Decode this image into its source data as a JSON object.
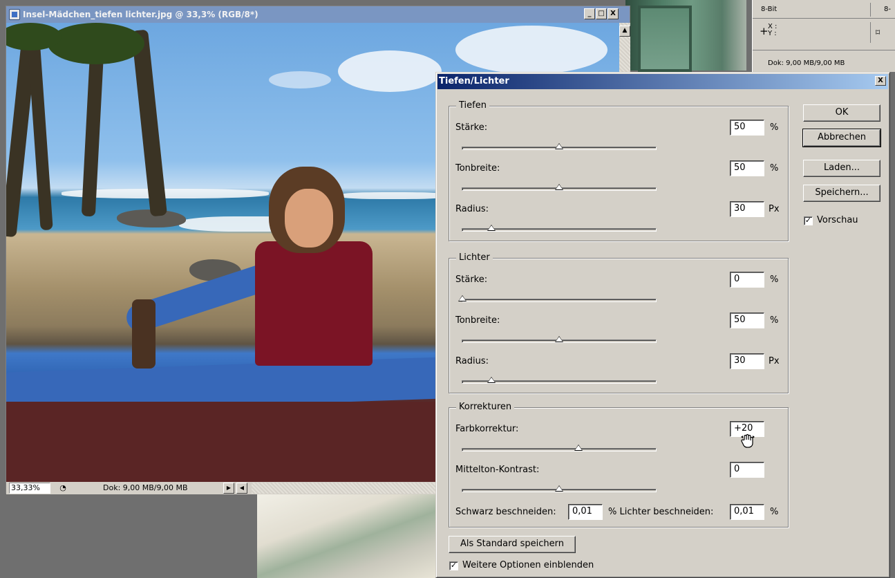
{
  "document": {
    "title": "Insel-Mädchen_tiefen lichter.jpg @ 33,3% (RGB/8*)",
    "zoom": "33,33%",
    "doc_info": "Dok: 9,00 MB/9,00 MB",
    "minimize_glyph": "_",
    "maximize_glyph": "□",
    "close_glyph": "X",
    "scroll_up_glyph": "▲",
    "nav_right_glyph": "▶",
    "nav_left_glyph": "◀"
  },
  "info_panel": {
    "bit_depth_left": "8-Bit",
    "bit_depth_right": "8-",
    "xy_label": "X :\nY :",
    "doc_info": "Dok: 9,00 MB/9,00 MB"
  },
  "dialog": {
    "title": "Tiefen/Lichter",
    "close_glyph": "X",
    "groups": {
      "tiefen": {
        "legend": "Tiefen",
        "staerke": {
          "label": "Stärke:",
          "value": "50",
          "unit": "%",
          "level": 0.5
        },
        "tonbreite": {
          "label": "Tonbreite:",
          "value": "50",
          "unit": "%",
          "level": 0.5
        },
        "radius": {
          "label": "Radius:",
          "value": "30",
          "unit": "Px",
          "level": 0.15
        }
      },
      "lichter": {
        "legend": "Lichter",
        "staerke": {
          "label": "Stärke:",
          "value": "0",
          "unit": "%",
          "level": 0.0
        },
        "tonbreite": {
          "label": "Tonbreite:",
          "value": "50",
          "unit": "%",
          "level": 0.5
        },
        "radius": {
          "label": "Radius:",
          "value": "30",
          "unit": "Px",
          "level": 0.15
        }
      },
      "korrekturen": {
        "legend": "Korrekturen",
        "farbkorrektur": {
          "label": "Farbkorrektur:",
          "value": "+20",
          "level": 0.6
        },
        "mittelton": {
          "label": "Mittelton-Kontrast:",
          "value": "0",
          "level": 0.5
        },
        "schwarz_label": "Schwarz beschneiden:",
        "schwarz_value": "0,01",
        "schwarz_unit": "% Lichter beschneiden:",
        "lichter_value": "0,01",
        "lichter_unit": "%"
      }
    },
    "buttons": {
      "ok": "OK",
      "abbrechen": "Abbrechen",
      "laden": "Laden...",
      "speichern": "Speichern...",
      "standard": "Als Standard speichern"
    },
    "vorschau": {
      "label": "Vorschau",
      "checked": true
    },
    "weitere": {
      "label": "Weitere Optionen einblenden",
      "checked": true
    },
    "check_glyph": "✓"
  }
}
